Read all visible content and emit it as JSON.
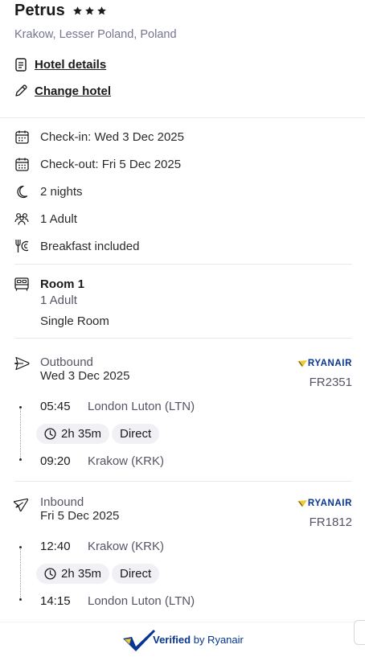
{
  "hotel": {
    "name": "Petrus",
    "star_count": 3,
    "location": "Krakow, Lesser Poland, Poland",
    "details_link": "Hotel details",
    "change_link": "Change hotel"
  },
  "stay": {
    "check_in": "Check-in: Wed 3 Dec 2025",
    "check_out": "Check-out: Fri 5 Dec 2025",
    "nights": "2 nights",
    "guests": "1 Adult",
    "board": "Breakfast included"
  },
  "room": {
    "title": "Room 1",
    "adults": "1 Adult",
    "type": "Single Room"
  },
  "outbound": {
    "label": "Outbound",
    "date": "Wed 3 Dec 2025",
    "airline": "RYANAIR",
    "flight_number": "FR2351",
    "depart_time": "05:45",
    "depart_place": "London Luton (LTN)",
    "duration": "2h 35m",
    "stops": "Direct",
    "arrive_time": "09:20",
    "arrive_place": "Krakow (KRK)"
  },
  "inbound": {
    "label": "Inbound",
    "date": "Fri 5 Dec 2025",
    "airline": "RYANAIR",
    "flight_number": "FR1812",
    "depart_time": "12:40",
    "depart_place": "Krakow (KRK)",
    "duration": "2h 35m",
    "stops": "Direct",
    "arrive_time": "14:15",
    "arrive_place": "London Luton (LTN)"
  },
  "footer": {
    "verified": "Verified",
    "by": "by Ryanair"
  },
  "colors": {
    "brand_blue": "#073590",
    "brand_yellow": "#f1c933",
    "muted_text": "#757592"
  },
  "icons": {
    "hotel_details": "document-icon",
    "change_hotel": "pencil-icon",
    "check_in": "calendar-icon",
    "check_out": "calendar-icon",
    "nights": "moon-icon",
    "guests": "people-icon",
    "board": "cutlery-icon",
    "room": "bed-icon",
    "outbound": "plane-departure-icon",
    "inbound": "plane-arrival-icon",
    "duration": "clock-icon",
    "verified": "verified-badge-icon"
  }
}
